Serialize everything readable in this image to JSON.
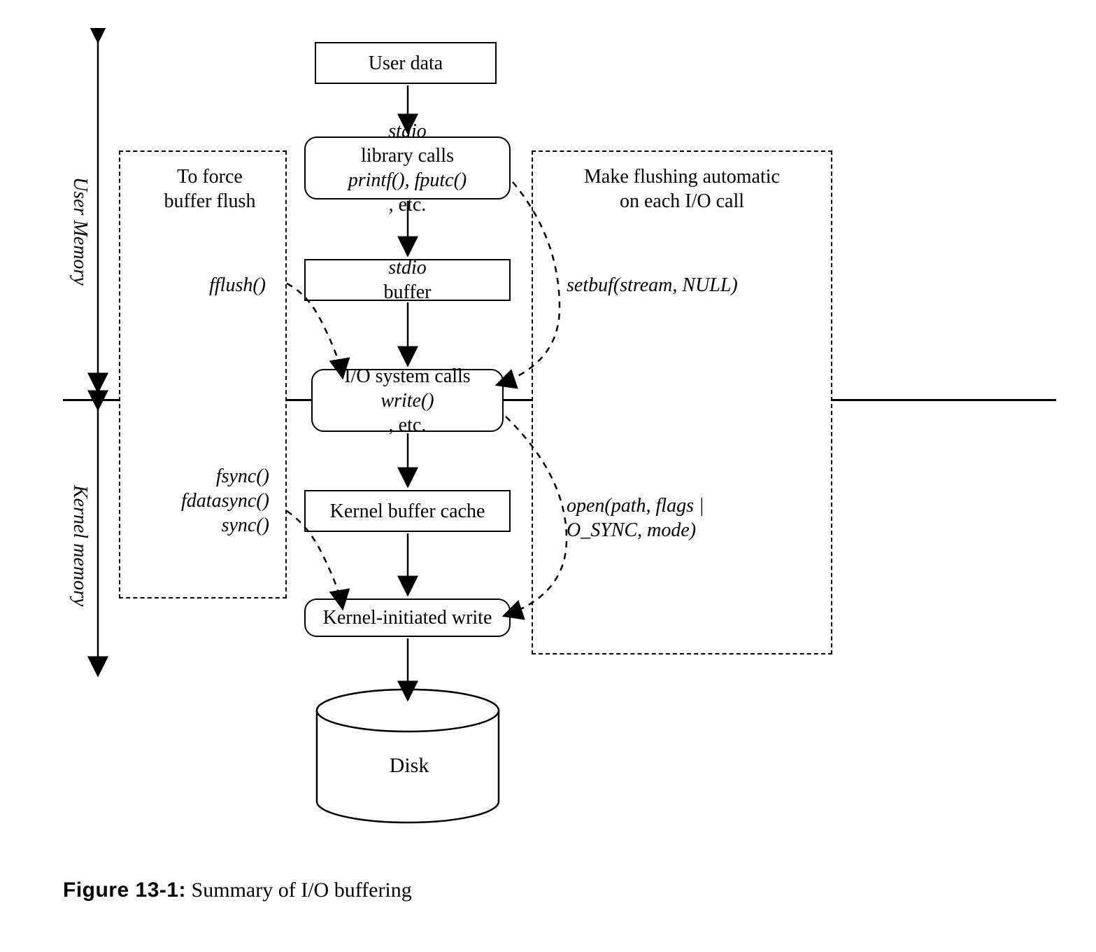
{
  "region_labels": {
    "user_memory": "User Memory",
    "kernel_memory": "Kernel memory"
  },
  "nodes": {
    "user_data": "User data",
    "stdio_calls_html": "<span class='ital'>stdio</span> library calls<br><span class='ital'>printf(), fputc()</span>, etc.",
    "stdio_buffer_html": "<span class='ital'>stdio</span> buffer",
    "io_syscalls_html": "I/O system calls<br><span class='ital'>write()</span>, etc.",
    "kernel_buffer_cache": "Kernel buffer cache",
    "kernel_initiated_write": "Kernel-initiated write",
    "disk": "Disk"
  },
  "left_panel": {
    "title_html": "To force<br>buffer flush",
    "top_call_html": "<span class='ital'>fflush()</span>",
    "bottom_calls_html": "<span class='ital'>fsync()<br>fdatasync()<br>sync()</span>"
  },
  "right_panel": {
    "title_html": "Make flushing automatic<br>on each I/O call",
    "top_call_html": "<span class='ital'>setbuf(stream, NULL)</span>",
    "bottom_call_html": "<span class='ital'>open(path, flags |<br>O_SYNC, mode)</span>"
  },
  "caption_html": "<b>Figure 13-1:</b> Summary of I/O buffering"
}
